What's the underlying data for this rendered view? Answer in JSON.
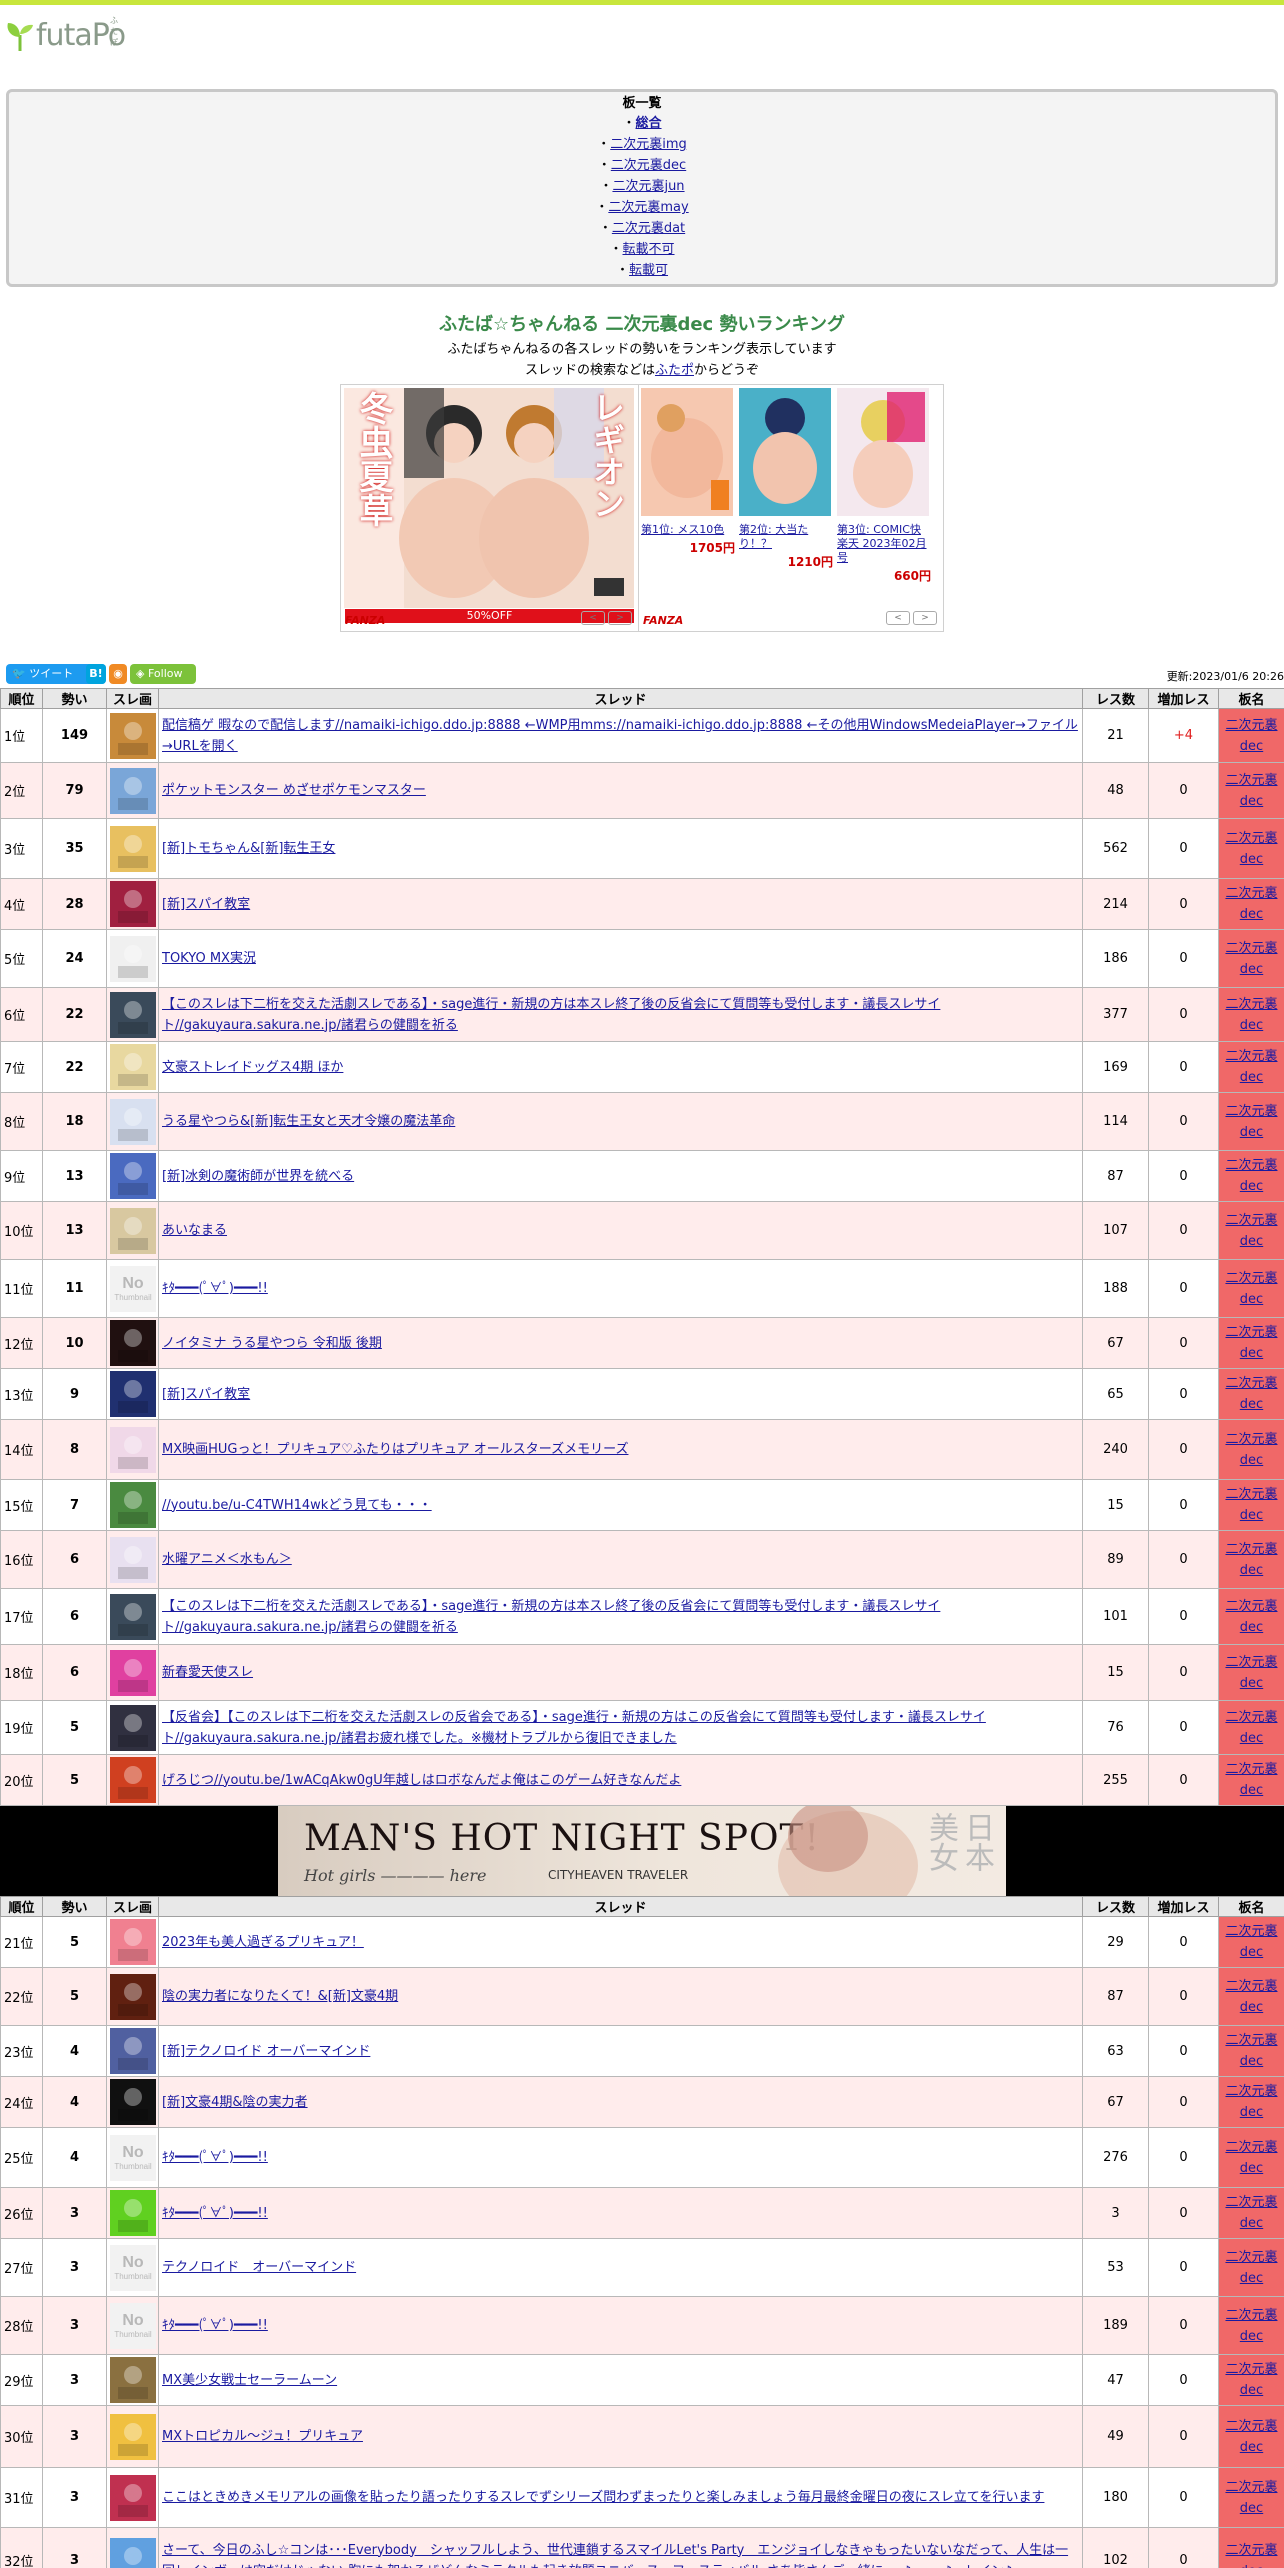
{
  "site": {
    "logo_text": "futaPo",
    "logo_ruby": "ふたぽ"
  },
  "boards": {
    "heading": "板一覧",
    "items": [
      {
        "label": "総合",
        "current": true
      },
      {
        "label": "二次元裏img"
      },
      {
        "label": "二次元裏dec"
      },
      {
        "label": "二次元裏jun"
      },
      {
        "label": "二次元裏may"
      },
      {
        "label": "二次元裏dat"
      },
      {
        "label": "転載不可"
      },
      {
        "label": "転載可"
      },
      {
        "label": "..."
      }
    ]
  },
  "page": {
    "title": "ふたば☆ちゃんねる 二次元裏dec 勢いランキング",
    "desc1": "ふたばちゃんねるの各スレッドの勢いをランキング表示しています",
    "desc2_pre": "スレッドの検索などは",
    "desc2_link": "ふたポ",
    "desc2_post": "からどうぞ"
  },
  "ads": {
    "main_title_a": "冬虫夏草",
    "main_title_b": "レギオン",
    "sale": "50%OFF",
    "brand": "FANZA",
    "items": [
      {
        "cap": "第1位: メス10色",
        "price": "1705円"
      },
      {
        "cap": "第2位: 大当たり！？",
        "price": "1210円"
      },
      {
        "cap": "第3位: COMIC快楽天 2023年02月号",
        "price": "660円"
      }
    ],
    "prev": "<",
    "next": ">"
  },
  "social": {
    "tweet": "ツイート",
    "hatena": "B!",
    "follow": "Follow",
    "updated": "更新:2023/01/6 20:26"
  },
  "table": {
    "headers": [
      "順位",
      "勢い",
      "スレ画",
      "スレッド",
      "レス数",
      "増加レス",
      "板名"
    ],
    "board_line1": "二次元裏",
    "board_line2": "dec",
    "rows1": [
      {
        "rank": "1位",
        "ikioi": "149",
        "title": "配信稿ゲ 暇なので配信します//namaiki-ichigo.ddo.jp:8888 ←WMP用mms://namaiki-ichigo.ddo.jp:8888 ←その他用WindowsMedeiaPlayer→ファイル→URLを開く",
        "res": "21",
        "inc": "+4",
        "h": 54,
        "thumb": "#c88a3a"
      },
      {
        "rank": "2位",
        "ikioi": "79",
        "title": "ポケットモンスター めざせポケモンマスター",
        "res": "48",
        "inc": "0",
        "h": 56,
        "thumb": "#7aa6d8"
      },
      {
        "rank": "3位",
        "ikioi": "35",
        "title": "[新]トモちゃん&[新]転生王女",
        "res": "562",
        "inc": "0",
        "h": 60,
        "thumb": "#e8c060"
      },
      {
        "rank": "4位",
        "ikioi": "28",
        "title": "[新]スパイ教室",
        "res": "214",
        "inc": "0",
        "h": 44,
        "thumb": "#a02040"
      },
      {
        "rank": "5位",
        "ikioi": "24",
        "title": "TOKYO MX実況",
        "res": "186",
        "inc": "0",
        "h": 58,
        "thumb": "#f0f0f0"
      },
      {
        "rank": "6位",
        "ikioi": "22",
        "title": "【このスレは下二桁を交えた活劇スレである】・sage進行・新規の方は本スレ終了後の反省会にて質問等も受付します・議長スレサイト//gakuyaura.sakura.ne.jp/諸君らの健闘を祈る",
        "res": "377",
        "inc": "0",
        "h": 54,
        "thumb": "#3a4a5a"
      },
      {
        "rank": "7位",
        "ikioi": "22",
        "title": "文豪ストレイドッグス4期 ほか",
        "res": "169",
        "inc": "0",
        "h": 44,
        "thumb": "#e8d8a0"
      },
      {
        "rank": "8位",
        "ikioi": "18",
        "title": "うる星やつら&[新]転生王女と天才令嬢の魔法革命",
        "res": "114",
        "inc": "0",
        "h": 58,
        "thumb": "#d8e0f0"
      },
      {
        "rank": "9位",
        "ikioi": "13",
        "title": "[新]冰剣の魔術師が世界を統べる",
        "res": "87",
        "inc": "0",
        "h": 46,
        "thumb": "#4a6ac0"
      },
      {
        "rank": "10位",
        "ikioi": "13",
        "title": "あいなまる",
        "res": "107",
        "inc": "0",
        "h": 58,
        "thumb": "#d8c8a0"
      },
      {
        "rank": "11位",
        "ikioi": "11",
        "title": "ｷﾀ━━━(ﾟ∀ﾟ)━━━!!",
        "res": "188",
        "inc": "0",
        "h": 58,
        "thumb": "nothumb"
      },
      {
        "rank": "12位",
        "ikioi": "10",
        "title": "ノイタミナ うる星やつら 令和版 後期",
        "res": "67",
        "inc": "0",
        "h": 42,
        "thumb": "#201010"
      },
      {
        "rank": "13位",
        "ikioi": "9",
        "title": "[新]スパイ教室",
        "res": "65",
        "inc": "0",
        "h": 42,
        "thumb": "#203070"
      },
      {
        "rank": "14位",
        "ikioi": "8",
        "title": "MX映画HUGっと！プリキュア♡ふたりはプリキュア オールスターズメモリーズ",
        "res": "240",
        "inc": "0",
        "h": 60,
        "thumb": "#f0d8e8"
      },
      {
        "rank": "15位",
        "ikioi": "7",
        "title": "//youtu.be/u-C4TWH14wkどう見ても・・・",
        "res": "15",
        "inc": "0",
        "h": 44,
        "thumb": "#4a8a40"
      },
      {
        "rank": "16位",
        "ikioi": "6",
        "title": "水曜アニメ＜水もん＞",
        "res": "89",
        "inc": "0",
        "h": 58,
        "thumb": "#e8e0f0"
      },
      {
        "rank": "17位",
        "ikioi": "6",
        "title": "【このスレは下二桁を交えた活劇スレである】・sage進行・新規の方は本スレ終了後の反省会にて質問等も受付します・議長スレサイト//gakuyaura.sakura.ne.jp/諸君らの健闘を祈る",
        "res": "101",
        "inc": "0",
        "h": 56,
        "thumb": "#3a4a5a"
      },
      {
        "rank": "18位",
        "ikioi": "6",
        "title": "新春愛天使スレ",
        "res": "15",
        "inc": "0",
        "h": 56,
        "thumb": "#e040a0"
      },
      {
        "rank": "19位",
        "ikioi": "5",
        "title": "【反省会】【このスレは下二桁を交えた活劇スレの反省会である】・sage進行・新規の方はこの反省会にて質問等も受付します・議長スレサイト//gakuyaura.sakura.ne.jp/諸君お疲れ様でした。※機材トラブルから復旧できました",
        "res": "76",
        "inc": "0",
        "h": 54,
        "thumb": "#303040"
      },
      {
        "rank": "20位",
        "ikioi": "5",
        "title": "げろじつ//youtu.be/1wACqAkw0gU年越しはロボなんだよ俺はこのゲーム好きなんだよ",
        "res": "255",
        "inc": "0",
        "h": 44,
        "thumb": "#d04020"
      }
    ],
    "rows2": [
      {
        "rank": "21位",
        "ikioi": "5",
        "title": "2023年も美人過ぎるプリキュア！",
        "res": "29",
        "inc": "0",
        "h": 46,
        "thumb": "#f08090"
      },
      {
        "rank": "22位",
        "ikioi": "5",
        "title": "陰の実力者になりたくて！&[新]文豪4期",
        "res": "87",
        "inc": "0",
        "h": 58,
        "thumb": "#602010"
      },
      {
        "rank": "23位",
        "ikioi": "4",
        "title": "[新]テクノロイド オーバーマインド",
        "res": "63",
        "inc": "0",
        "h": 46,
        "thumb": "#5060a0"
      },
      {
        "rank": "24位",
        "ikioi": "4",
        "title": "[新]文豪4期&陰の実力者",
        "res": "67",
        "inc": "0",
        "h": 44,
        "thumb": "#101010"
      },
      {
        "rank": "25位",
        "ikioi": "4",
        "title": "ｷﾀ━━━(ﾟ∀ﾟ)━━━!!",
        "res": "276",
        "inc": "0",
        "h": 60,
        "thumb": "nothumb"
      },
      {
        "rank": "26位",
        "ikioi": "3",
        "title": "ｷﾀ━━━(ﾟ∀ﾟ)━━━!!",
        "res": "3",
        "inc": "0",
        "h": 50,
        "thumb": "#60d020"
      },
      {
        "rank": "27位",
        "ikioi": "3",
        "title": "テクノロイド　オーバーマインド",
        "res": "53",
        "inc": "0",
        "h": 58,
        "thumb": "nothumb"
      },
      {
        "rank": "28位",
        "ikioi": "3",
        "title": "ｷﾀ━━━(ﾟ∀ﾟ)━━━!!",
        "res": "189",
        "inc": "0",
        "h": 58,
        "thumb": "nothumb"
      },
      {
        "rank": "29位",
        "ikioi": "3",
        "title": "MX美少女戦士セーラームーン",
        "res": "47",
        "inc": "0",
        "h": 44,
        "thumb": "#8a7040"
      },
      {
        "rank": "30位",
        "ikioi": "3",
        "title": "MXトロピカル～ジュ！プリキュア",
        "res": "49",
        "inc": "0",
        "h": 62,
        "thumb": "#f0c040"
      },
      {
        "rank": "31位",
        "ikioi": "3",
        "title": "ここはときめきメモリアルの画像を貼ったり語ったりするスレでずシリーズ問わずまったりと楽しみましょう毎月最終金曜日の夜にスレ立てを行います",
        "res": "180",
        "inc": "0",
        "h": 60,
        "thumb": "#c03050"
      },
      {
        "rank": "32位",
        "ikioi": "3",
        "title": "さーて、今日のふし☆コンは･･･Everybody　シャッフルしよう、世代連鎖するスマイルLet's Party　エンジョイしなきゃもったいないなだって、人生は一回レインボーは空だけじゃない 胸にも架かるぜどんなミラクルも起き放題ユニバース・フェスティバル さあ皆さんご一緒に･･･♪　･･･♪　レイン♪",
        "res": "102",
        "inc": "0",
        "h": 66,
        "thumb": "#60a0e0"
      }
    ]
  },
  "banner": {
    "title": "MAN'S HOT NIGHT SPOT!",
    "sub": "Hot girls ———— here",
    "logo": "CITYHEAVEN TRAVELER",
    "kanji": "日本美女"
  }
}
